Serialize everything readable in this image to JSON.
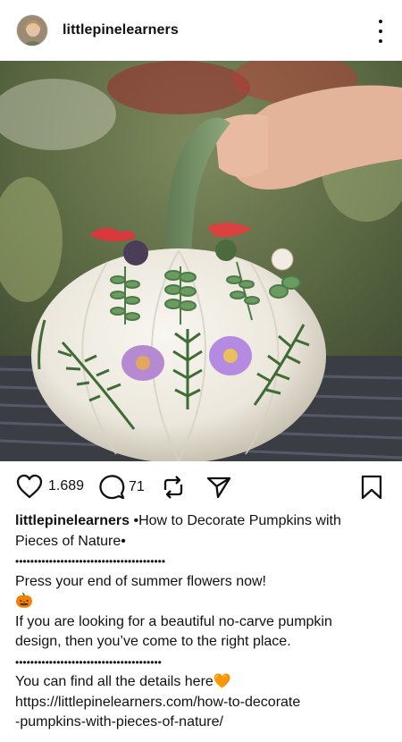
{
  "header": {
    "username": "littlepinelearners"
  },
  "icons": {
    "avatar": "profile-photo",
    "more": "more-vertical-icon",
    "like": "heart-icon",
    "comment": "comment-icon",
    "repost": "repost-icon",
    "share": "send-icon",
    "save": "bookmark-icon"
  },
  "image": {
    "subject": "pumpkin-decorated-with-pressed-flowers"
  },
  "actions": {
    "likes": "1.689",
    "comments": "71"
  },
  "caption": {
    "username": "littlepinelearners",
    "line1_rest": " •How to Decorate Pumpkins with",
    "line2": "Pieces of Nature•",
    "dots1": "••••••••••••••••••••••••••••••••••••••••",
    "line3": "Press your end of summer flowers now!",
    "line4": "🎃",
    "line5": "If you are looking for a beautiful no-carve pumpkin",
    "line6": "design, then you’ve come to the right place.",
    "dots2": "•••••••••••••••••••••••••••••••••••••••",
    "line7": "You can find all the details here🧡",
    "line8": "https://littlepinelearners.com/how-to-decorate",
    "line9": "-pumpkins-with-pieces-of-nature/"
  }
}
